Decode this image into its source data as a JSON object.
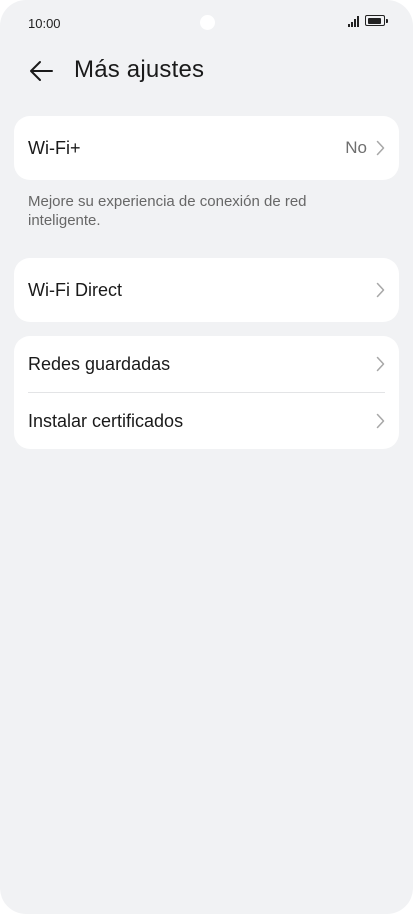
{
  "status_bar": {
    "time": "10:00"
  },
  "header": {
    "title": "Más ajustes"
  },
  "wifi_plus": {
    "label": "Wi-Fi+",
    "value": "No",
    "description": "Mejore su experiencia de conexión de red inteligente."
  },
  "wifi_direct": {
    "label": "Wi-Fi Direct"
  },
  "saved_networks": {
    "label": "Redes guardadas"
  },
  "install_certificates": {
    "label": "Instalar certificados"
  }
}
